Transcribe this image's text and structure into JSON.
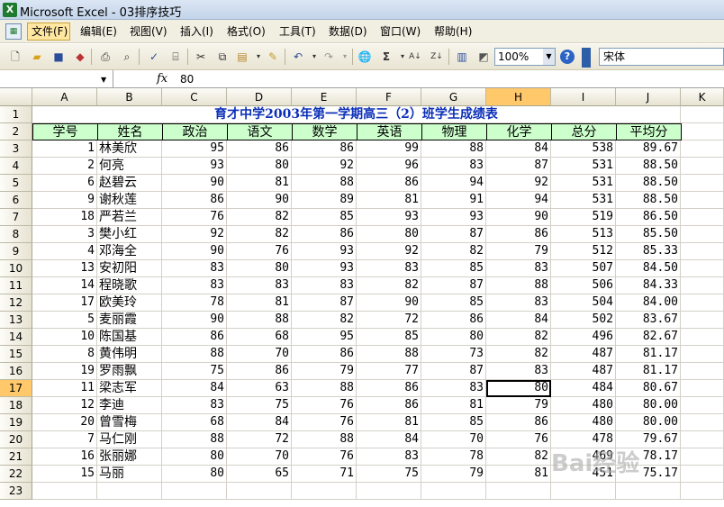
{
  "window": {
    "title": "Microsoft Excel - 03排序技巧",
    "app_icon": "excel-icon"
  },
  "menu": [
    {
      "label": "文件(F)",
      "active": true
    },
    {
      "label": "编辑(E)"
    },
    {
      "label": "视图(V)"
    },
    {
      "label": "插入(I)"
    },
    {
      "label": "格式(O)"
    },
    {
      "label": "工具(T)"
    },
    {
      "label": "数据(D)"
    },
    {
      "label": "窗口(W)"
    },
    {
      "label": "帮助(H)"
    }
  ],
  "toolbar": {
    "zoom": "100%",
    "font": "宋体",
    "help": "?",
    "sigma": "Σ"
  },
  "formula_bar": {
    "name_box": "",
    "fx": "fx",
    "value": "80"
  },
  "columns": [
    "A",
    "B",
    "C",
    "D",
    "E",
    "F",
    "G",
    "H",
    "I",
    "J",
    "K"
  ],
  "selected_column": "H",
  "selected_row": 17,
  "rows": [
    1,
    2,
    3,
    4,
    5,
    6,
    7,
    8,
    9,
    10,
    11,
    12,
    13,
    14,
    15,
    16,
    17,
    18,
    19,
    20,
    21,
    22,
    23
  ],
  "sheet": {
    "title": "育才中学2003年第一学期高三（2）班学生成绩表",
    "headers": [
      "学号",
      "姓名",
      "政治",
      "语文",
      "数学",
      "英语",
      "物理",
      "化学",
      "总分",
      "平均分"
    ],
    "records": [
      [
        "1",
        "林美欣",
        "95",
        "86",
        "86",
        "99",
        "88",
        "84",
        "538",
        "89.67"
      ],
      [
        "2",
        "何亮",
        "93",
        "80",
        "92",
        "96",
        "83",
        "87",
        "531",
        "88.50"
      ],
      [
        "6",
        "赵碧云",
        "90",
        "81",
        "88",
        "86",
        "94",
        "92",
        "531",
        "88.50"
      ],
      [
        "9",
        "谢秋莲",
        "86",
        "90",
        "89",
        "81",
        "91",
        "94",
        "531",
        "88.50"
      ],
      [
        "18",
        "严若兰",
        "76",
        "82",
        "85",
        "93",
        "93",
        "90",
        "519",
        "86.50"
      ],
      [
        "3",
        "樊小红",
        "92",
        "82",
        "86",
        "80",
        "87",
        "86",
        "513",
        "85.50"
      ],
      [
        "4",
        "邓海全",
        "90",
        "76",
        "93",
        "92",
        "82",
        "79",
        "512",
        "85.33"
      ],
      [
        "13",
        "安初阳",
        "83",
        "80",
        "93",
        "83",
        "85",
        "83",
        "507",
        "84.50"
      ],
      [
        "14",
        "程晓歌",
        "83",
        "83",
        "83",
        "82",
        "87",
        "88",
        "506",
        "84.33"
      ],
      [
        "17",
        "欧美玲",
        "78",
        "81",
        "87",
        "90",
        "85",
        "83",
        "504",
        "84.00"
      ],
      [
        "5",
        "麦丽霞",
        "90",
        "88",
        "82",
        "72",
        "86",
        "84",
        "502",
        "83.67"
      ],
      [
        "10",
        "陈国基",
        "86",
        "68",
        "95",
        "85",
        "80",
        "82",
        "496",
        "82.67"
      ],
      [
        "8",
        "黄伟明",
        "88",
        "70",
        "86",
        "88",
        "73",
        "82",
        "487",
        "81.17"
      ],
      [
        "19",
        "罗雨飘",
        "75",
        "86",
        "79",
        "77",
        "87",
        "83",
        "487",
        "81.17"
      ],
      [
        "11",
        "梁志军",
        "84",
        "63",
        "88",
        "86",
        "83",
        "80",
        "484",
        "80.67"
      ],
      [
        "12",
        "李迪",
        "83",
        "75",
        "76",
        "86",
        "81",
        "79",
        "480",
        "80.00"
      ],
      [
        "20",
        "曾雪梅",
        "68",
        "84",
        "76",
        "81",
        "85",
        "86",
        "480",
        "80.00"
      ],
      [
        "7",
        "马仁刚",
        "88",
        "72",
        "88",
        "84",
        "70",
        "76",
        "478",
        "79.67"
      ],
      [
        "16",
        "张丽娜",
        "80",
        "70",
        "76",
        "83",
        "78",
        "82",
        "469",
        "78.17"
      ],
      [
        "15",
        "马丽",
        "80",
        "65",
        "71",
        "75",
        "79",
        "81",
        "451",
        "75.17"
      ]
    ]
  },
  "watermark": "Bai经验"
}
